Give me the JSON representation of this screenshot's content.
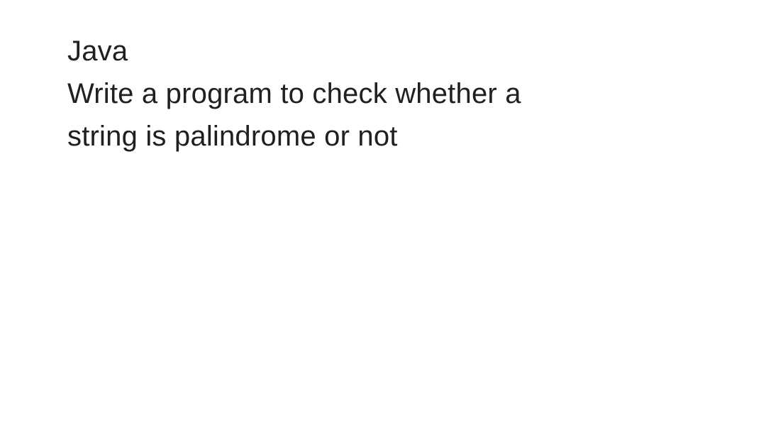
{
  "content": {
    "line1": "Java",
    "line2": "Write a program to check whether a",
    "line3": "string is palindrome or not"
  }
}
